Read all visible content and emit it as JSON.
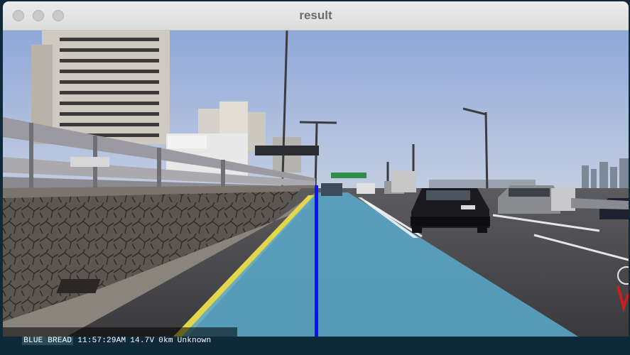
{
  "window": {
    "title": "result",
    "buttons": [
      "close",
      "minimize",
      "zoom"
    ]
  },
  "dashcam_overlay": {
    "brand": "BLUE BREAD",
    "time": "11:57:29AM",
    "voltage": "14.7V",
    "speed": "0km",
    "location": "Unknown"
  },
  "detection": {
    "lane_fill_color": "#5aa7c9",
    "center_line_color": "#1010ff"
  }
}
